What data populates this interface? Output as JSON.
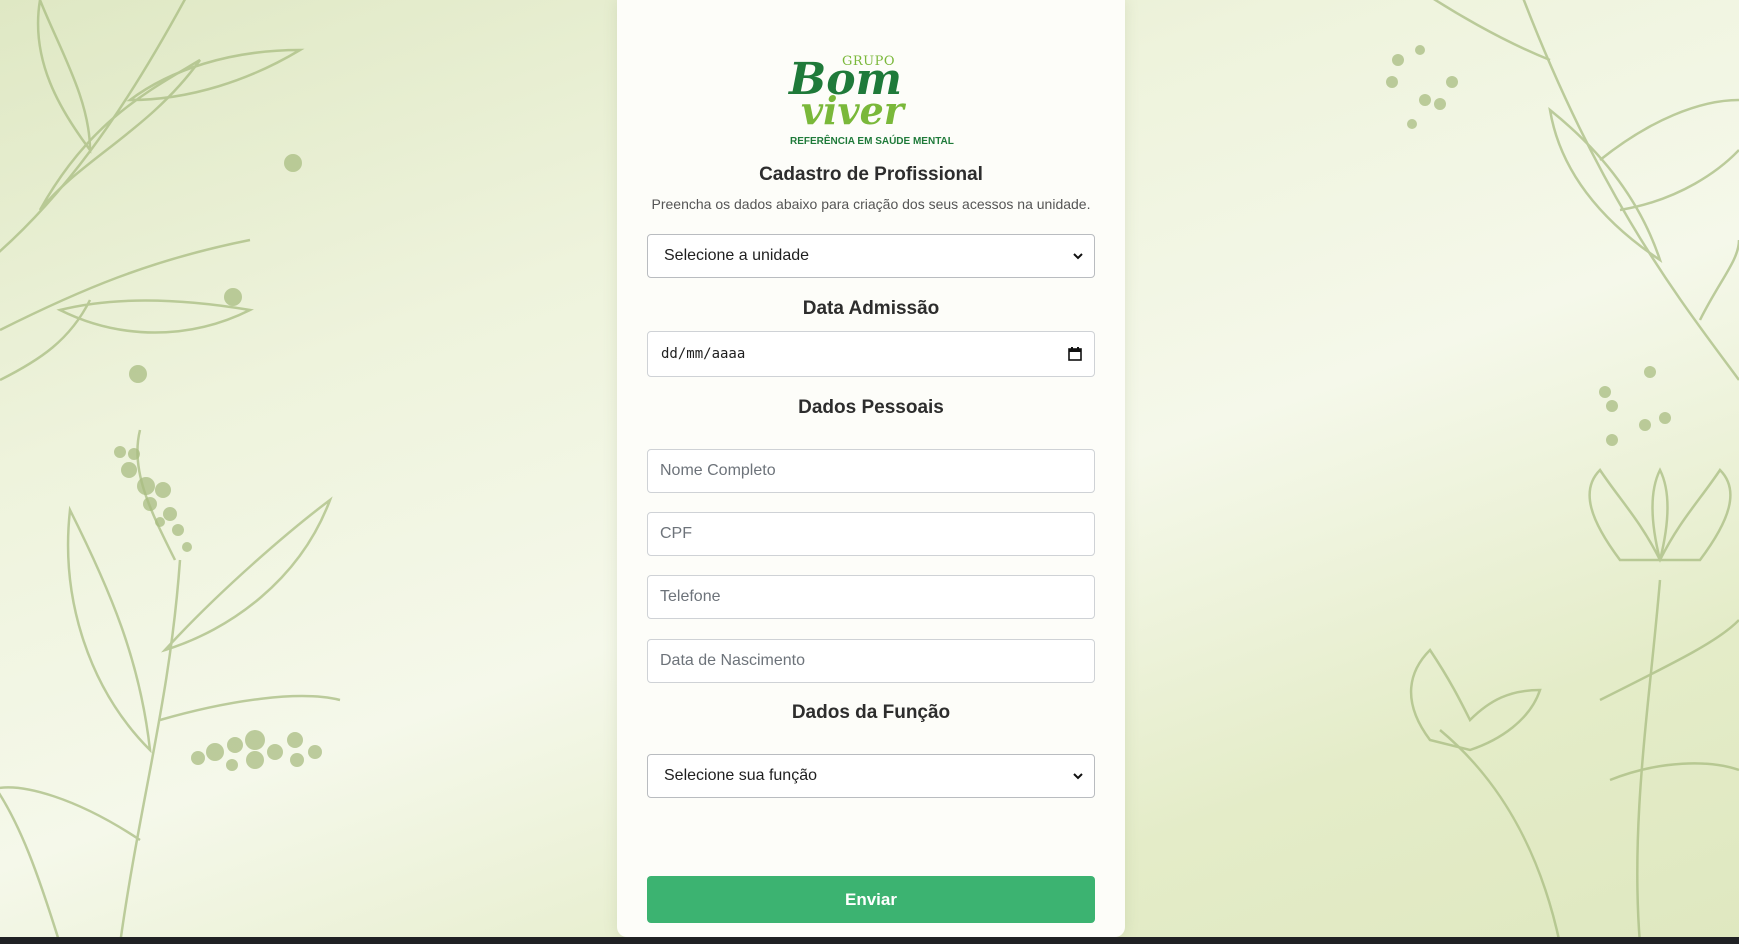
{
  "brand": {
    "logo_group": "GRUPO",
    "logo_line1": "Bom",
    "logo_line2": "viver",
    "logo_tagline": "REFERÊNCIA EM SAÚDE MENTAL"
  },
  "form": {
    "title": "Cadastro de Profissional",
    "subtitle": "Preencha os dados abaixo para criação dos seus acessos na unidade.",
    "unit_select": "Selecione a unidade",
    "admission_heading": "Data Admissão",
    "admission_date": "dd/mm/aaaa",
    "personal_heading": "Dados Pessoais",
    "name_placeholder": "Nome Completo",
    "cpf_placeholder": "CPF",
    "phone_placeholder": "Telefone",
    "birth_placeholder": "Data de Nascimento",
    "role_heading": "Dados da Função",
    "role_select": "Selecione sua função",
    "submit_label": "Enviar"
  },
  "icons": {
    "select_arrow": "chevron-down-icon",
    "date_picker": "calendar-icon"
  },
  "colors": {
    "accent": "#3cb371",
    "brand_dark_green": "#1f7a3a",
    "brand_light_green": "#7ab83a",
    "background": "#e6eed0"
  }
}
